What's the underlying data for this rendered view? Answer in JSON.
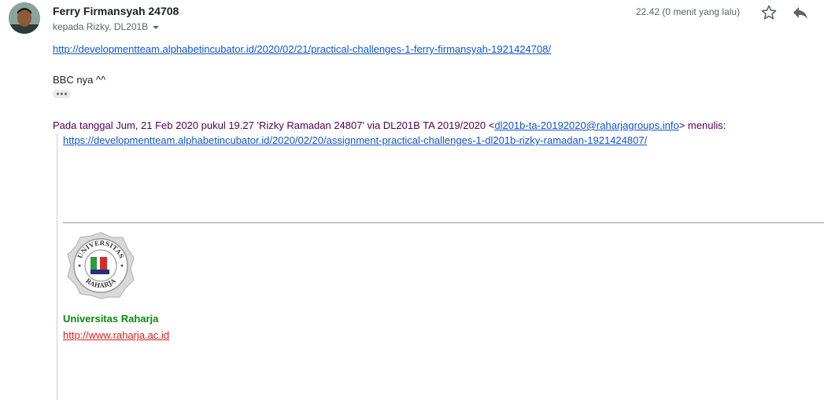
{
  "header": {
    "sender_name": "Ferry Firmansyah 24708",
    "recipients": "kepada Rizky, DL201B",
    "timestamp": "22.42 (0 menit yang lalu)",
    "icons": {
      "star": "star-icon",
      "reply": "reply-icon",
      "caret": "chevron-down-icon"
    }
  },
  "message": {
    "link": "http://developmentteam.alphabetincubator.id/2020/02/21/practical-challenges-1-ferry-firmansyah-1921424708/",
    "body_text": "BBC nya ^^"
  },
  "quoted": {
    "header_prefix": "Pada tanggal Jum, 21 Feb 2020 pukul 19.27 'Rizky Ramadan 24807' via DL201B TA 2019/2020 <",
    "header_email": "dl201b-ta-20192020@raharjagroups.info",
    "header_suffix": "> menulis:",
    "link": "https://developmentteam.alphabetincubator.id/2020/02/20/assignment-practical-challenges-1-dl201b-rizky-ramadan-1921424807/",
    "signature": {
      "logo_text_top": "UNIVERSITAS",
      "logo_text_bottom": "RAHARJA",
      "name": "Universitas Raharja",
      "url": "http://www.raharja.ac.id"
    }
  },
  "colors": {
    "link": "#1155cc",
    "quote_header": "#500050",
    "signature_name": "#0b8a0b",
    "signature_url": "#e02020"
  }
}
